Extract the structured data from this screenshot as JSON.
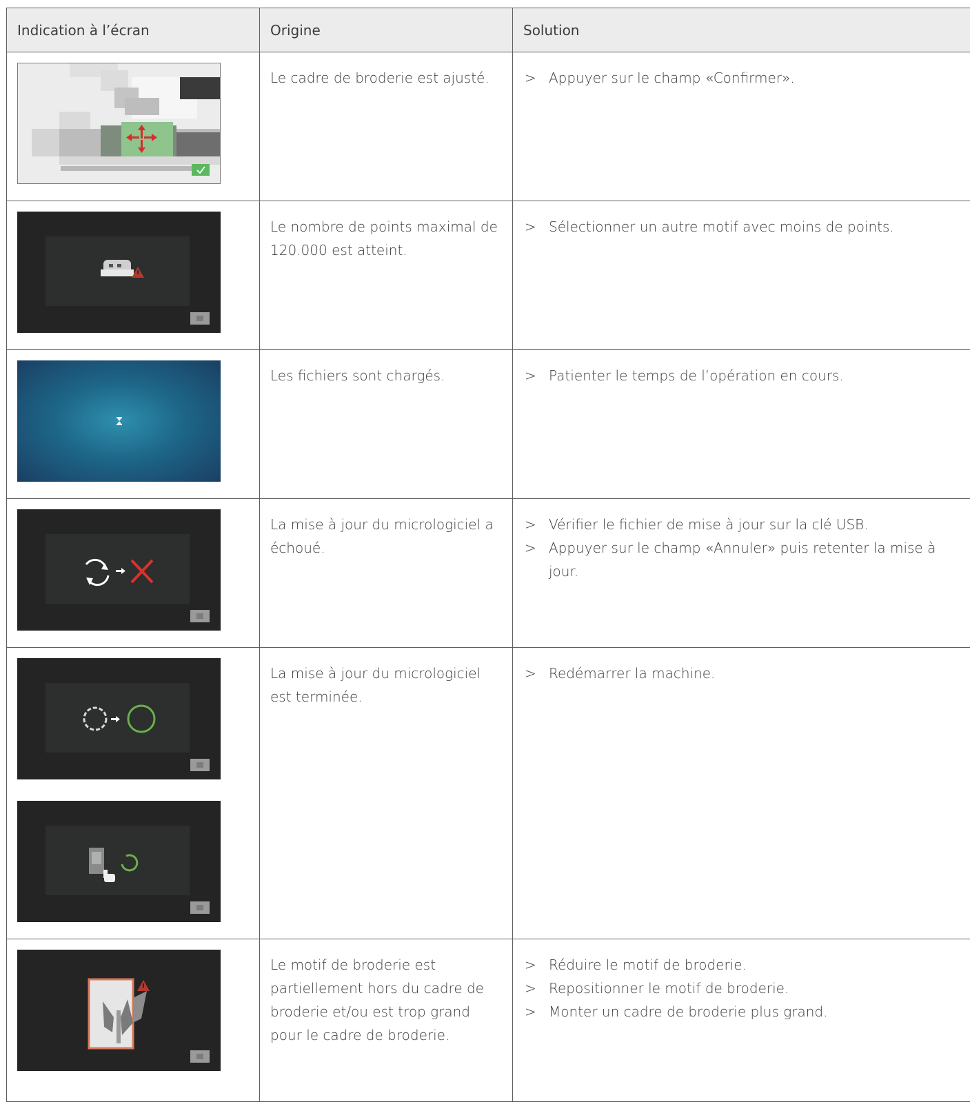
{
  "table": {
    "headers": [
      "Indication à l’écran",
      "Origine",
      "Solution"
    ],
    "rows": [
      {
        "cause": "Le cadre de broderie est ajusté.",
        "solutions": [
          "Appuyer sur le champ «Confirmer»."
        ],
        "screens": [
          "hoop-adjust-screen"
        ]
      },
      {
        "cause": "Le nombre de points maximal de 120.000 est atteint.",
        "solutions": [
          "Sélectionner un autre motif avec moins de points."
        ],
        "screens": [
          "stitch-limit-screen"
        ]
      },
      {
        "cause": "Les fichiers sont chargés.",
        "solutions": [
          "Patienter le temps de l’opération en cours."
        ],
        "screens": [
          "loading-screen"
        ]
      },
      {
        "cause": "La mise à jour du micrologiciel a échoué.",
        "solutions": [
          "Vérifier le fichier de mise à jour sur la clé USB.",
          "Appuyer sur le champ «Annuler» puis retenter la mise à jour."
        ],
        "screens": [
          "update-failed-screen"
        ]
      },
      {
        "cause": "La mise à jour du micrologiciel est terminée.",
        "solutions": [
          "Redémarrer la machine."
        ],
        "screens": [
          "update-complete-screen",
          "restart-screen"
        ]
      },
      {
        "cause": "Le motif de broderie est partiellement hors du cadre de broderie et/ou est trop grand pour le cadre de broderie.",
        "solutions": [
          "Réduire le motif de broderie.",
          "Repositionner le motif de broderie.",
          "Monter un cadre de broderie plus grand."
        ],
        "screens": [
          "design-outside-hoop-screen"
        ]
      }
    ]
  },
  "bullet": ">",
  "colors": {
    "border": "#5f5f5f",
    "header_bg": "#ececec",
    "screen_dark": "#242424",
    "screen_panel": "#2d2e2e",
    "alert_red": "#c93a2e",
    "ok_green": "#6ab04c",
    "confirm_green": "#5cb85c",
    "hoop_orange": "#d7795a"
  }
}
